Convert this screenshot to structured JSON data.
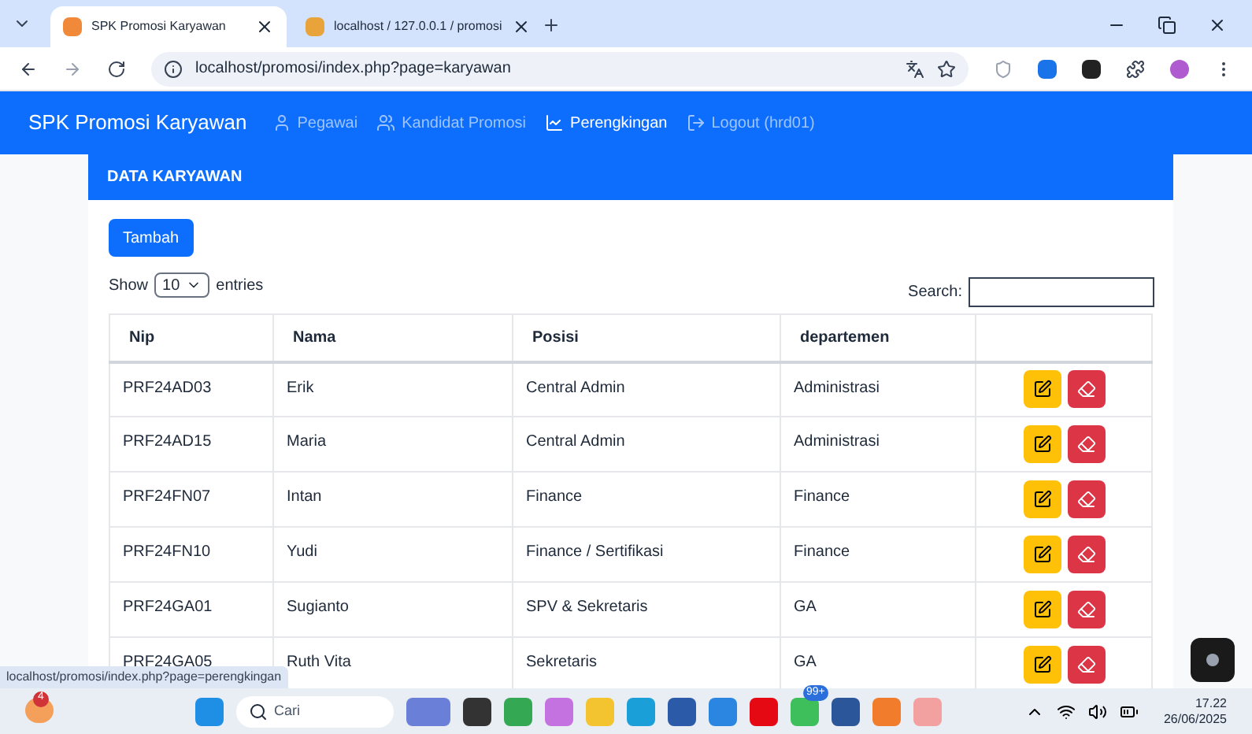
{
  "browser": {
    "tabs": [
      {
        "title": "SPK Promosi Karyawan",
        "selected": true
      },
      {
        "title": "localhost / 127.0.0.1 / promosi",
        "selected": false
      }
    ],
    "url": "localhost/promosi/index.php?page=karyawan",
    "status_url": "localhost/promosi/index.php?page=perengkingan"
  },
  "navbar": {
    "brand": "SPK Promosi Karyawan",
    "items": [
      {
        "label": "Pegawai",
        "kind": "person",
        "selected": false
      },
      {
        "label": "Kandidat Promosi",
        "kind": "users",
        "selected": false
      },
      {
        "label": "Perengkingan",
        "kind": "chart",
        "selected": true
      },
      {
        "label": "Logout (hrd01)",
        "kind": "logout",
        "selected": false
      }
    ]
  },
  "card": {
    "title": "DATA KARYAWAN",
    "add_button": "Tambah",
    "show_label": "Show",
    "entries_value": "10",
    "entries_label": "entries",
    "search_label": "Search:",
    "table": {
      "columns": [
        "Nip",
        "Nama",
        "Posisi",
        "departemen"
      ],
      "rows": [
        [
          "PRF24AD03",
          "Erik",
          "Central Admin",
          "Administrasi"
        ],
        [
          "PRF24AD15",
          "Maria",
          "Central Admin",
          "Administrasi"
        ],
        [
          "PRF24FN07",
          "Intan",
          "Finance",
          "Finance"
        ],
        [
          "PRF24FN10",
          "Yudi",
          "Finance / Sertifikasi",
          "Finance"
        ],
        [
          "PRF24GA01",
          "Sugianto",
          "SPV & Sekretaris",
          "GA"
        ],
        [
          "PRF24GA05",
          "Ruth Vita",
          "Sekretaris",
          "GA"
        ]
      ]
    }
  },
  "taskbar": {
    "weather_badge": "4",
    "search_placeholder": "Cari",
    "whatsapp_badge": "99+",
    "time": "17.22",
    "date": "26/06/2025"
  }
}
